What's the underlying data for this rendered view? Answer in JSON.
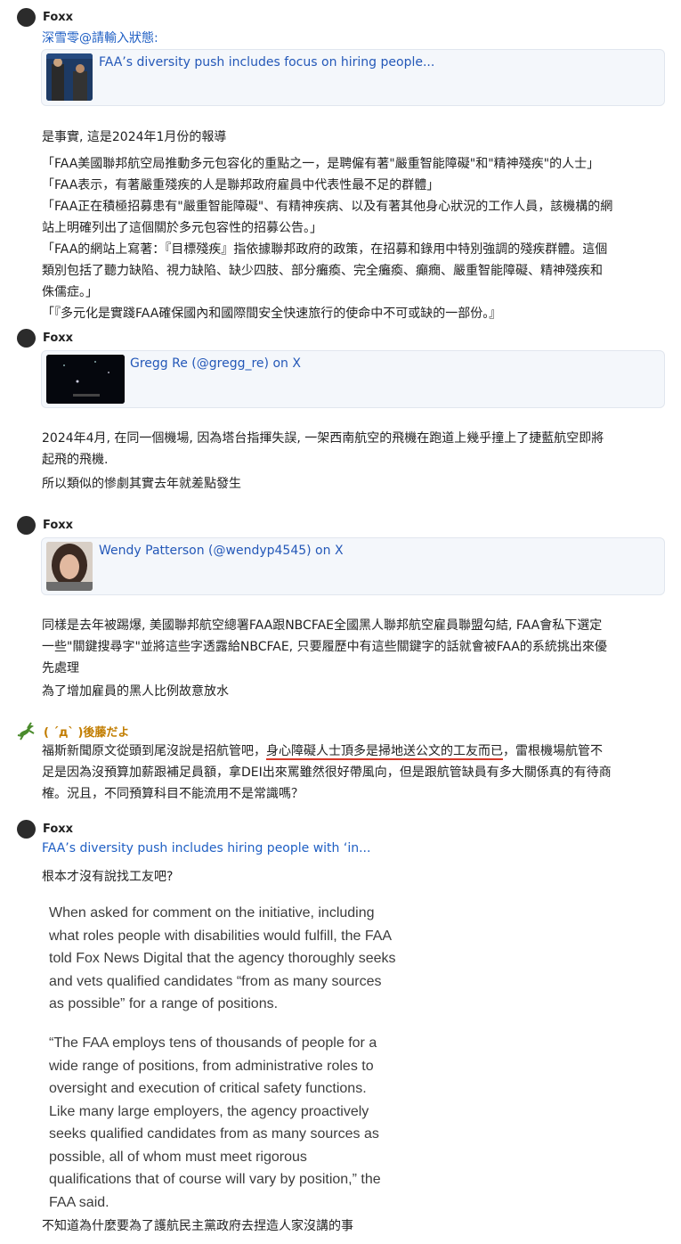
{
  "post1": {
    "author": "Foxx",
    "quote_ref": "深雪零@請輸入狀態:",
    "card_title": "FAA’s diversity push includes focus on hiring people...",
    "lines": [
      "是事實, 這是2024年1月份的報導",
      "「FAA美國聯邦航空局推動多元包容化的重點之一，是聘僱有著\"嚴重智能障礙\"和\"精神殘疾\"的人士」",
      "「FAA表示，有著嚴重殘疾的人是聯邦政府雇員中代表性最不足的群體」",
      "「FAA正在積極招募患有\"嚴重智能障礙\"、有精神疾病、以及有著其他身心狀況的工作人員，該機構的網",
      "站上明確列出了這個關於多元包容性的招募公告。」",
      "「FAA的網站上寫著：『目標殘疾』指依據聯邦政府的政策，在招募和錄用中特別強調的殘疾群體。這個",
      "類別包括了聽力缺陷、視力缺陷、缺少四肢、部分癱瘓、完全癱瘓、癲癇、嚴重智能障礙、精神殘疾和",
      "侏儒症。」",
      "「『多元化是實踐FAA確保國內和國際間安全快速旅行的使命中不可或缺的一部份。』"
    ]
  },
  "post2": {
    "author": "Foxx",
    "card_title": "Gregg Re (@gregg_re) on X",
    "lines": [
      "2024年4月, 在同一個機場, 因為塔台指揮失誤, 一架西南航空的飛機在跑道上幾乎撞上了捷藍航空即將",
      "起飛的飛機.",
      "所以類似的慘劇其實去年就差點發生"
    ]
  },
  "post3": {
    "author": "Foxx",
    "card_title": "Wendy Patterson (@wendyp4545) on X",
    "lines": [
      "同樣是去年被踢爆, 美國聯邦航空總署FAA跟NBCFAE全國黑人聯邦航空雇員聯盟勾結, FAA會私下選定",
      "一些\"關鍵搜尋字\"並將這些字透露給NBCFAE, 只要履歷中有這些關鍵字的話就會被FAA的系統挑出來優",
      "先處理",
      "為了增加雇員的黑人比例故意放水"
    ]
  },
  "post4": {
    "author": "( ´д` )後藤だよ",
    "line1_pre": "福斯新聞原文從頭到尾沒說是招航管吧，",
    "line1_underlined": "身心障礙人士頂多是掃地送公文的工友而已",
    "line1_post": "，雷根機場航管不",
    "line2": "足是因為沒預算加薪跟補足員額，拿DEI出來罵雖然很好帶風向，但是跟航管缺員有多大關係真的有待商",
    "line3": "榷。況且，不同預算科目不能流用不是常識嗎？"
  },
  "post5": {
    "author": "Foxx",
    "link": "FAA’s diversity push includes hiring people with ‘in...",
    "line1": "根本才沒有說找工友吧?",
    "excerpt_p1": [
      "When asked for comment on the initiative, including",
      "what roles people with disabilities would fulfill, the FAA",
      "told Fox News Digital that the agency thoroughly seeks",
      "and vets qualified candidates “from as many sources",
      "as possible” for a range of positions."
    ],
    "excerpt_p2": [
      "“The FAA employs tens of thousands of people for a",
      "wide range of positions, from administrative roles to",
      "oversight and execution of critical safety functions.",
      "Like many large employers, the agency proactively",
      "seeks qualified candidates from as many sources as",
      "possible, all of whom must meet rigorous",
      "qualifications that of course will vary by position,” the",
      "FAA said."
    ],
    "last_line": "不知道為什麼要為了護航民主黨政府去捏造人家沒講的事"
  },
  "colors": {
    "link": "#1f5fc4",
    "card_bg": "#f4f7fb",
    "underline": "#d43a2a",
    "goto_author": "#c27d00"
  }
}
